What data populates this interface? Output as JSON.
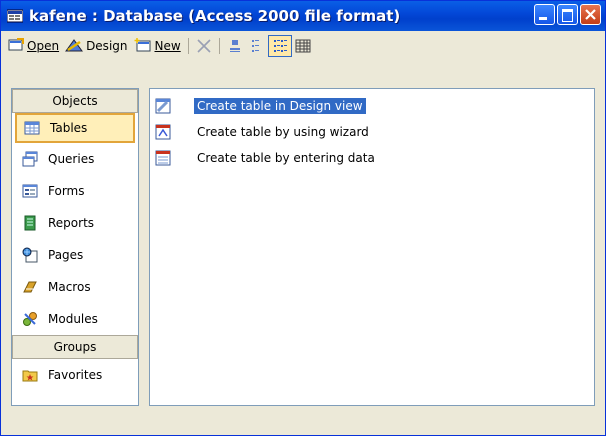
{
  "window": {
    "title": "kafene : Database (Access 2000 file format)"
  },
  "toolbar": {
    "open_label": "Open",
    "design_label": "Design",
    "new_label": "New"
  },
  "objects_panel": {
    "objects_header": "Objects",
    "items": [
      {
        "label": "Tables",
        "icon": "tables-icon",
        "selected": true
      },
      {
        "label": "Queries",
        "icon": "queries-icon",
        "selected": false
      },
      {
        "label": "Forms",
        "icon": "forms-icon",
        "selected": false
      },
      {
        "label": "Reports",
        "icon": "reports-icon",
        "selected": false
      },
      {
        "label": "Pages",
        "icon": "pages-icon",
        "selected": false
      },
      {
        "label": "Macros",
        "icon": "macros-icon",
        "selected": false
      },
      {
        "label": "Modules",
        "icon": "modules-icon",
        "selected": false
      }
    ],
    "groups_header": "Groups",
    "groups": [
      {
        "label": "Favorites",
        "icon": "favorites-icon"
      }
    ]
  },
  "main_list": {
    "items": [
      {
        "label": "Create table in Design view",
        "selected": true
      },
      {
        "label": "Create table by using wizard",
        "selected": false
      },
      {
        "label": "Create table by entering data",
        "selected": false
      }
    ]
  },
  "colors": {
    "titlebar": "#0348d8",
    "selection": "#316ac5",
    "panel_highlight": "#ffefb9"
  }
}
